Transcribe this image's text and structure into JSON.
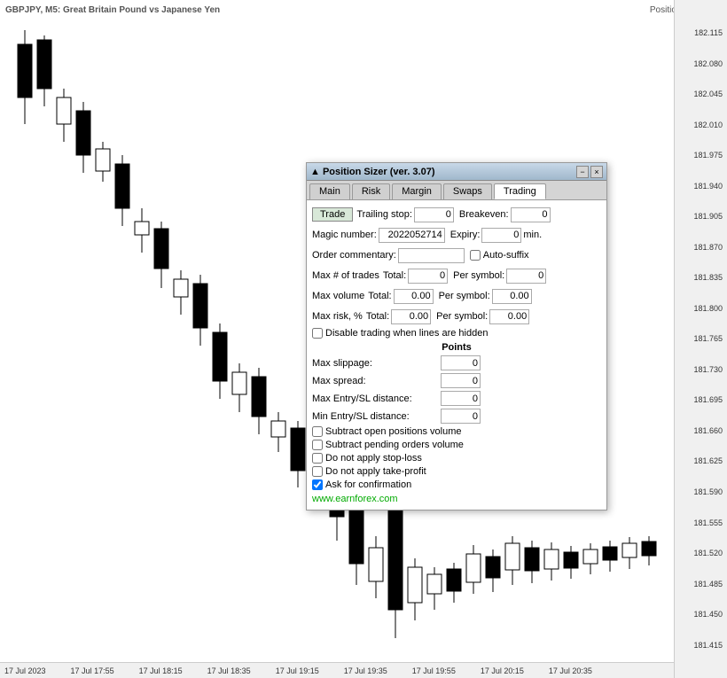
{
  "chart": {
    "title": "GBPJPY, M5: Great Britain Pound vs Japanese Yen",
    "position_sizer_label": "Position Sizer",
    "prices": [
      "182.115",
      "182.080",
      "182.045",
      "182.010",
      "181.975",
      "181.940",
      "181.905",
      "181.870",
      "181.835",
      "181.800",
      "181.765",
      "181.730",
      "181.695",
      "181.660",
      "181.625",
      "181.590",
      "181.555",
      "181.520",
      "181.485",
      "181.450",
      "181.415"
    ],
    "times": [
      "17 Jul 2023",
      "17 Jul 17:55",
      "17 Jul 18:15",
      "17 Jul 18:35",
      "17 Jul 19:15",
      "17 Jul 19:35",
      "17 Jul 19:55",
      "17 Jul 20:15",
      "17 Jul 20:35"
    ]
  },
  "dialog": {
    "title": "Position Sizer (ver. 3.07)",
    "minimize_label": "−",
    "close_label": "×",
    "tabs": [
      "Main",
      "Risk",
      "Margin",
      "Swaps",
      "Trading"
    ],
    "active_tab": "Trading",
    "trade_button": "Trade",
    "trailing_stop_label": "Trailing stop:",
    "trailing_stop_value": "0",
    "breakeven_label": "Breakeven:",
    "breakeven_value": "0",
    "magic_number_label": "Magic number:",
    "magic_number_value": "2022052714",
    "expiry_label": "Expiry:",
    "expiry_value": "0",
    "expiry_unit": "min.",
    "order_commentary_label": "Order commentary:",
    "order_commentary_value": "",
    "auto_suffix_label": "Auto-suffix",
    "auto_suffix_checked": false,
    "max_trades_label": "Max # of trades",
    "max_trades_total_label": "Total:",
    "max_trades_total_value": "0",
    "max_trades_per_symbol_label": "Per symbol:",
    "max_trades_per_symbol_value": "0",
    "max_volume_label": "Max volume",
    "max_volume_total_label": "Total:",
    "max_volume_total_value": "0.00",
    "max_volume_per_symbol_label": "Per symbol:",
    "max_volume_per_symbol_value": "0.00",
    "max_risk_label": "Max risk, %",
    "max_risk_total_label": "Total:",
    "max_risk_total_value": "0.00",
    "max_risk_per_symbol_label": "Per symbol:",
    "max_risk_per_symbol_value": "0.00",
    "disable_trading_label": "Disable trading when lines are hidden",
    "disable_trading_checked": false,
    "points_header": "Points",
    "max_slippage_label": "Max slippage:",
    "max_slippage_value": "0",
    "max_spread_label": "Max spread:",
    "max_spread_value": "0",
    "max_entry_sl_label": "Max Entry/SL distance:",
    "max_entry_sl_value": "0",
    "min_entry_sl_label": "Min Entry/SL distance:",
    "min_entry_sl_value": "0",
    "subtract_open_label": "Subtract open positions volume",
    "subtract_open_checked": false,
    "subtract_pending_label": "Subtract pending orders volume",
    "subtract_pending_checked": false,
    "do_not_apply_sl_label": "Do not apply stop-loss",
    "do_not_apply_sl_checked": false,
    "do_not_apply_tp_label": "Do not apply take-profit",
    "do_not_apply_tp_checked": false,
    "ask_confirmation_label": "Ask for confirmation",
    "ask_confirmation_checked": true,
    "earn_link": "www.earnforex.com"
  }
}
